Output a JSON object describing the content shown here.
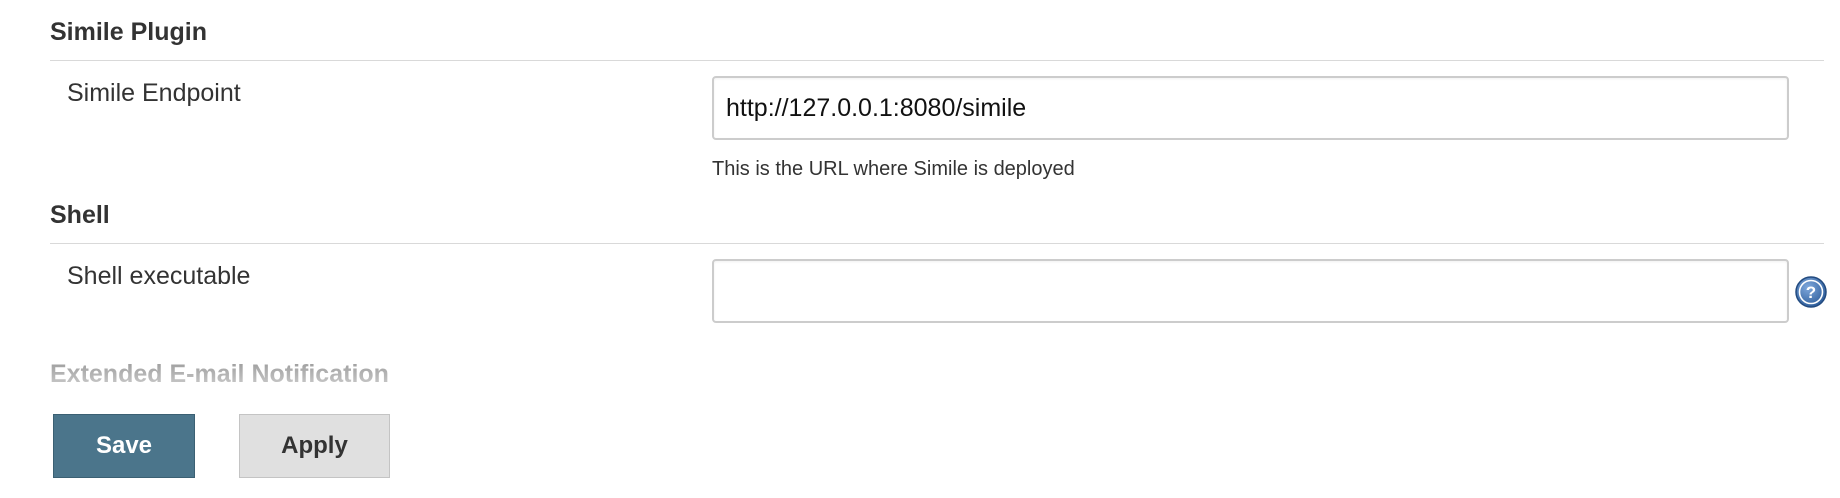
{
  "sections": {
    "simile": {
      "title": "Simile Plugin",
      "endpoint_label": "Simile Endpoint",
      "endpoint_value": "http://127.0.0.1:8080/simile",
      "endpoint_help": "This is the URL where Simile is deployed"
    },
    "shell": {
      "title": "Shell",
      "executable_label": "Shell executable",
      "executable_value": "",
      "help_icon": "question-mark-help-icon"
    },
    "email": {
      "title": "Extended E-mail Notification"
    }
  },
  "buttons": {
    "save_label": "Save",
    "apply_label": "Apply"
  },
  "colors": {
    "save_button": "#4b758b",
    "apply_button": "#e0e0e0",
    "help_icon": "#2f5f9e"
  }
}
